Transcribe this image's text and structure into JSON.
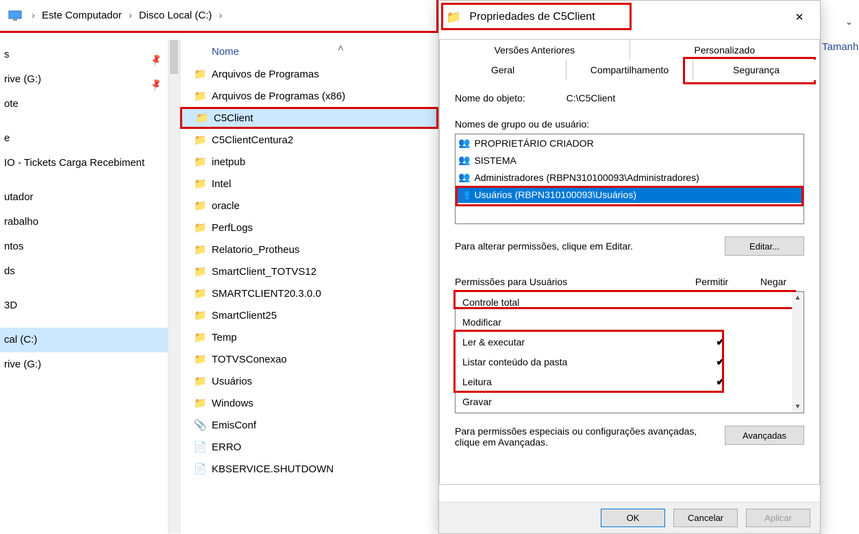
{
  "breadcrumb": {
    "l1": "Este Computador",
    "l2": "Disco Local (C:)"
  },
  "tree": {
    "items": [
      {
        "label": "s",
        "pinned": true
      },
      {
        "label": "rive (G:)",
        "pinned": true
      },
      {
        "label": "ote"
      },
      {
        "label": ""
      },
      {
        "label": "e"
      },
      {
        "label": "IO - Tickets Carga Recebiment"
      },
      {
        "label": ""
      },
      {
        "label": "utador"
      },
      {
        "label": "rabalho"
      },
      {
        "label": "ntos"
      },
      {
        "label": "ds"
      },
      {
        "label": ""
      },
      {
        "label": "3D"
      },
      {
        "label": ""
      },
      {
        "label": "cal (C:)",
        "selected": true
      },
      {
        "label": "rive (G:)"
      }
    ]
  },
  "columns": {
    "name": "Nome",
    "size": "Tamanho"
  },
  "files": [
    {
      "label": "Arquivos de Programas",
      "type": "folder"
    },
    {
      "label": "Arquivos de Programas (x86)",
      "type": "folder"
    },
    {
      "label": "C5Client",
      "type": "folder",
      "selected": true,
      "highlight": true
    },
    {
      "label": "C5ClientCentura2",
      "type": "folder"
    },
    {
      "label": "inetpub",
      "type": "folder"
    },
    {
      "label": "Intel",
      "type": "folder"
    },
    {
      "label": "oracle",
      "type": "folder"
    },
    {
      "label": "PerfLogs",
      "type": "folder"
    },
    {
      "label": "Relatorio_Protheus",
      "type": "folder"
    },
    {
      "label": "SmartClient_TOTVS12",
      "type": "folder"
    },
    {
      "label": "SMARTCLIENT20.3.0.0",
      "type": "folder"
    },
    {
      "label": "SmartClient25",
      "type": "folder"
    },
    {
      "label": "Temp",
      "type": "folder"
    },
    {
      "label": "TOTVSConexao",
      "type": "folder"
    },
    {
      "label": "Usuários",
      "type": "folder"
    },
    {
      "label": "Windows",
      "type": "folder"
    },
    {
      "label": "EmisConf",
      "type": "file"
    },
    {
      "label": "ERRO",
      "type": "text"
    },
    {
      "label": "KBSERVICE.SHUTDOWN",
      "type": "text"
    }
  ],
  "dialog": {
    "title": "Propriedades de C5Client",
    "tabs": {
      "prev": "Versões Anteriores",
      "custom": "Personalizado",
      "general": "Geral",
      "sharing": "Compartilhamento",
      "security": "Segurança"
    },
    "object_name_label": "Nome do objeto:",
    "object_name_value": "C:\\C5Client",
    "groups_label": "Nomes de grupo ou de usuário:",
    "groups": [
      "PROPRIETÁRIO CRIADOR",
      "SISTEMA",
      "Administradores (RBPN310100093\\Administradores)",
      "Usuários (RBPN310100093\\Usuários)"
    ],
    "edit_text": "Para alterar permissões, clique em Editar.",
    "edit_btn": "Editar...",
    "perm_header": "Permissões para Usuários",
    "allow": "Permitir",
    "deny": "Negar",
    "perms": [
      {
        "label": "Controle total",
        "allow": false
      },
      {
        "label": "Modificar",
        "allow": false
      },
      {
        "label": "Ler & executar",
        "allow": true
      },
      {
        "label": "Listar conteúdo da pasta",
        "allow": true
      },
      {
        "label": "Leitura",
        "allow": true
      },
      {
        "label": "Gravar",
        "allow": false
      }
    ],
    "adv_text": "Para permissões especiais ou configurações avançadas, clique em Avançadas.",
    "adv_btn": "Avançadas",
    "ok": "OK",
    "cancel": "Cancelar",
    "apply": "Aplicar"
  }
}
